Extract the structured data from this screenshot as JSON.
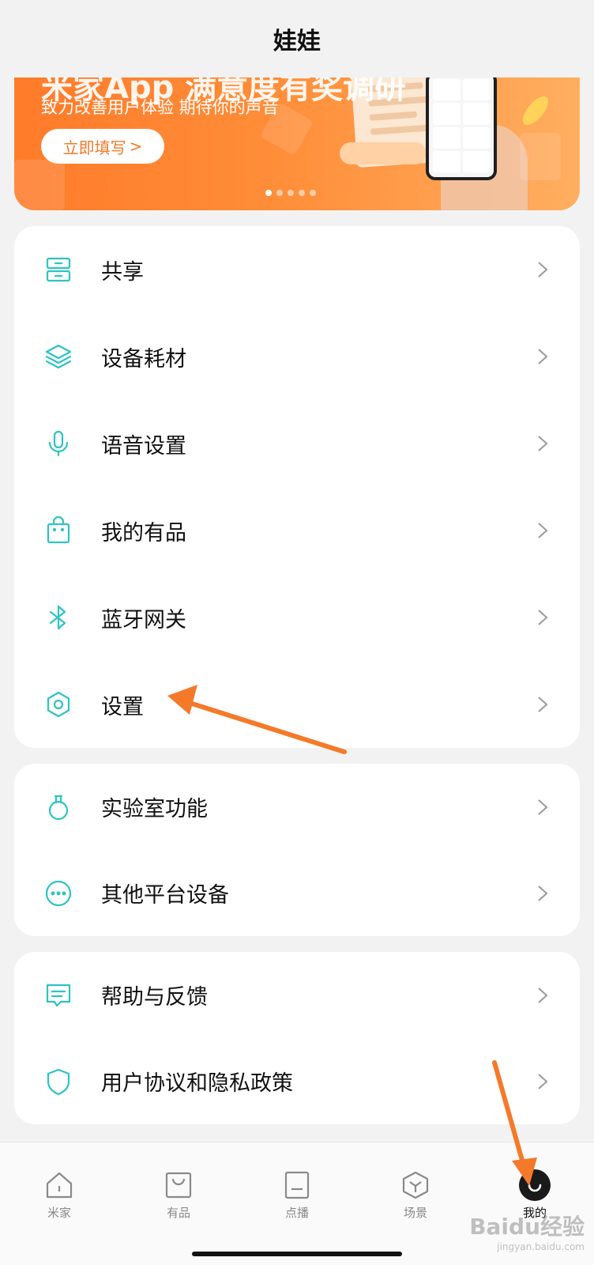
{
  "header": {
    "title": "娃娃"
  },
  "banner": {
    "title": "米家App 满意度有奖调研",
    "subtitle": "致力改善用户体验 期待你的声音",
    "button_label": "立即填写",
    "button_chevron": ">",
    "page_indicator": {
      "count": 5,
      "active_index": 0
    },
    "accent_color": "#ff7b2a"
  },
  "menu_group_1": [
    {
      "label": "共享",
      "icon": "share-drawer-icon"
    },
    {
      "label": "设备耗材",
      "icon": "layers-icon"
    },
    {
      "label": "语音设置",
      "icon": "microphone-icon"
    },
    {
      "label": "我的有品",
      "icon": "shopping-bag-icon"
    },
    {
      "label": "蓝牙网关",
      "icon": "bluetooth-icon"
    },
    {
      "label": "设置",
      "icon": "hexagon-gear-icon"
    }
  ],
  "menu_group_2": [
    {
      "label": "实验室功能",
      "icon": "flask-icon"
    },
    {
      "label": "其他平台设备",
      "icon": "more-dots-icon"
    }
  ],
  "menu_group_3": [
    {
      "label": "帮助与反馈",
      "icon": "feedback-icon"
    },
    {
      "label": "用户协议和隐私政策",
      "icon": "shield-icon"
    }
  ],
  "tabbar": [
    {
      "label": "米家",
      "icon": "home-icon",
      "active": false
    },
    {
      "label": "有品",
      "icon": "bag-icon",
      "active": false
    },
    {
      "label": "点播",
      "icon": "tv-icon",
      "active": false
    },
    {
      "label": "场景",
      "icon": "scene-cube-icon",
      "active": false
    },
    {
      "label": "我的",
      "icon": "profile-smile-icon",
      "active": true
    }
  ],
  "icon_color": "#2ec3c3",
  "annotation_color": "#f47a2a",
  "watermark": {
    "text": "Baidu经验",
    "sub": "jingyan.baidu.com"
  }
}
